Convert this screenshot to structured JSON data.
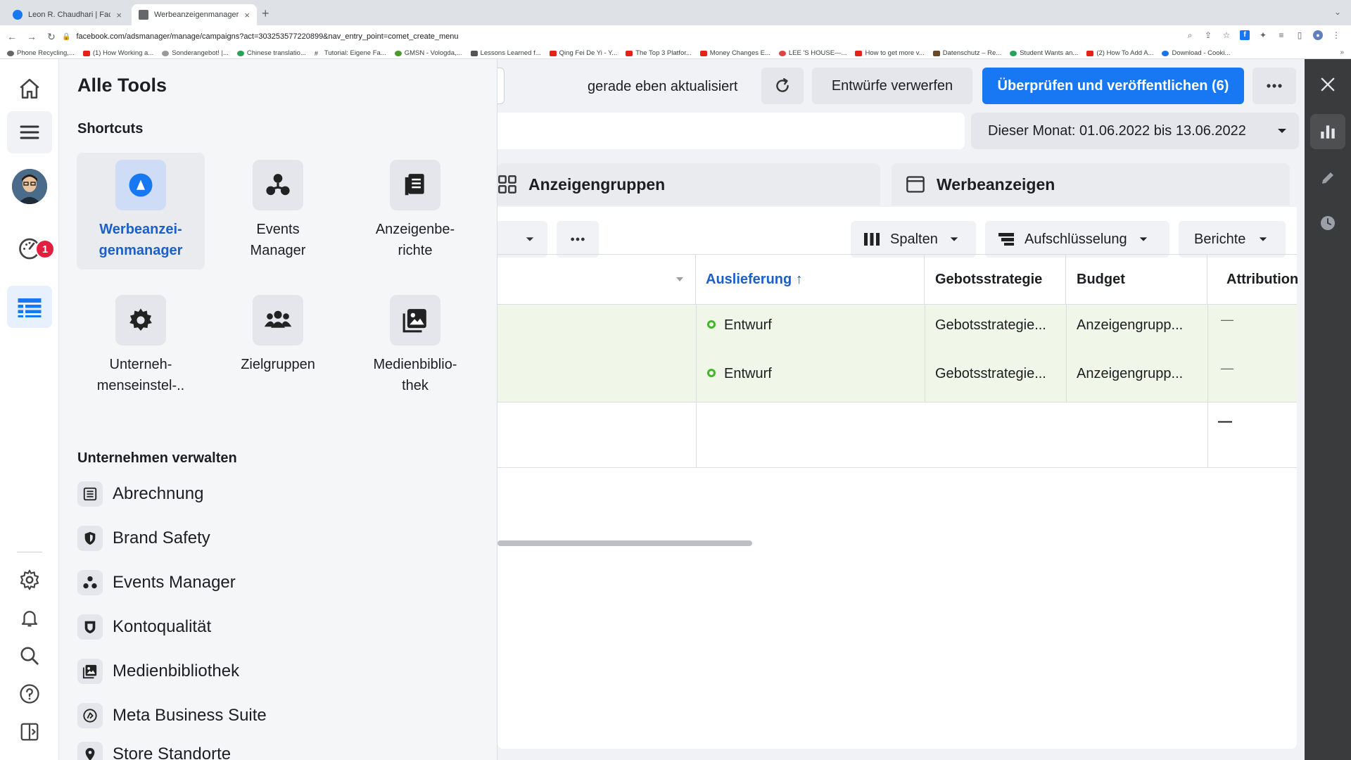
{
  "browser": {
    "tabs": [
      {
        "title": "Leon R. Chaudhari | Facebook",
        "active": false
      },
      {
        "title": "Werbeanzeigenmanager - Wer",
        "active": true
      }
    ],
    "url": "facebook.com/adsmanager/manage/campaigns?act=303253577220899&nav_entry_point=comet_create_menu",
    "bookmarks": [
      "Phone Recycling,...",
      "(1) How Working a...",
      "Sonderangebot! |...",
      "Chinese translatio...",
      "Tutorial: Eigene Fa...",
      "GMSN - Vologda,...",
      "Lessons Learned f...",
      "Qing Fei De Yi - Y...",
      "The Top 3 Platfor...",
      "Money Changes E...",
      "LEE 'S HOUSE—...",
      "How to get more v...",
      "Datenschutz – Re...",
      "Student Wants an...",
      "(2) How To Add A...",
      "Download - Cooki..."
    ]
  },
  "leftrail": {
    "notification_count": "1"
  },
  "drawer": {
    "title": "Alle Tools",
    "shortcuts_title": "Shortcuts",
    "shortcuts": [
      {
        "label": "Werbeanzei-\ngenmanager",
        "icon": "adsmanager-icon"
      },
      {
        "label": "Events\nManager",
        "icon": "events-manager-icon"
      },
      {
        "label": "Anzeigenbe-\nrichte",
        "icon": "ad-reports-icon"
      },
      {
        "label": "Unterneh-\nmenseinstel-..",
        "icon": "gear-icon"
      },
      {
        "label": "Zielgruppen",
        "icon": "audiences-icon"
      },
      {
        "label": "Medienbiblio-\nthek",
        "icon": "media-library-icon"
      }
    ],
    "manage_title": "Unternehmen verwalten",
    "manage_items": [
      {
        "label": "Abrechnung",
        "icon": "billing-icon"
      },
      {
        "label": "Brand Safety",
        "icon": "shield-icon"
      },
      {
        "label": "Events Manager",
        "icon": "events-manager-icon"
      },
      {
        "label": "Kontoqualität",
        "icon": "account-quality-icon"
      },
      {
        "label": "Medienbibliothek",
        "icon": "media-library-icon"
      },
      {
        "label": "Meta Business Suite",
        "icon": "business-suite-icon"
      },
      {
        "label": "Store Standorte",
        "icon": "location-icon"
      }
    ]
  },
  "content": {
    "status_text": "gerade eben aktualisiert",
    "discard_label": "Entwürfe verwerfen",
    "publish_label": "Überprüfen und veröffentlichen (6)",
    "date_range": "Dieser Monat: 01.06.2022 bis 13.06.2022",
    "tabs": {
      "adsets": "Anzeigengruppen",
      "ads": "Werbeanzeigen"
    },
    "toolbar": {
      "columns": "Spalten",
      "breakdown": "Aufschlüsselung",
      "reports": "Berichte"
    },
    "columns": {
      "delivery": "Auslieferung ↑",
      "bid_strategy": "Gebotsstrategie",
      "budget": "Budget",
      "attribution": "Attribution"
    },
    "rows": [
      {
        "delivery": "Entwurf",
        "bid_strategy": "Gebotsstrategie...",
        "budget": "Anzeigengrupp...",
        "attribution": "—"
      },
      {
        "delivery": "Entwurf",
        "bid_strategy": "Gebotsstrategie...",
        "budget": "Anzeigengrupp...",
        "attribution": "—"
      }
    ],
    "summary_attribution": "—"
  },
  "colors": {
    "brand_blue": "#1877f2",
    "selected_text": "#1b5fc7",
    "draft_green": "#42b72a",
    "draft_row": "#f0f7e8",
    "right_rail": "#3a3b3c"
  }
}
